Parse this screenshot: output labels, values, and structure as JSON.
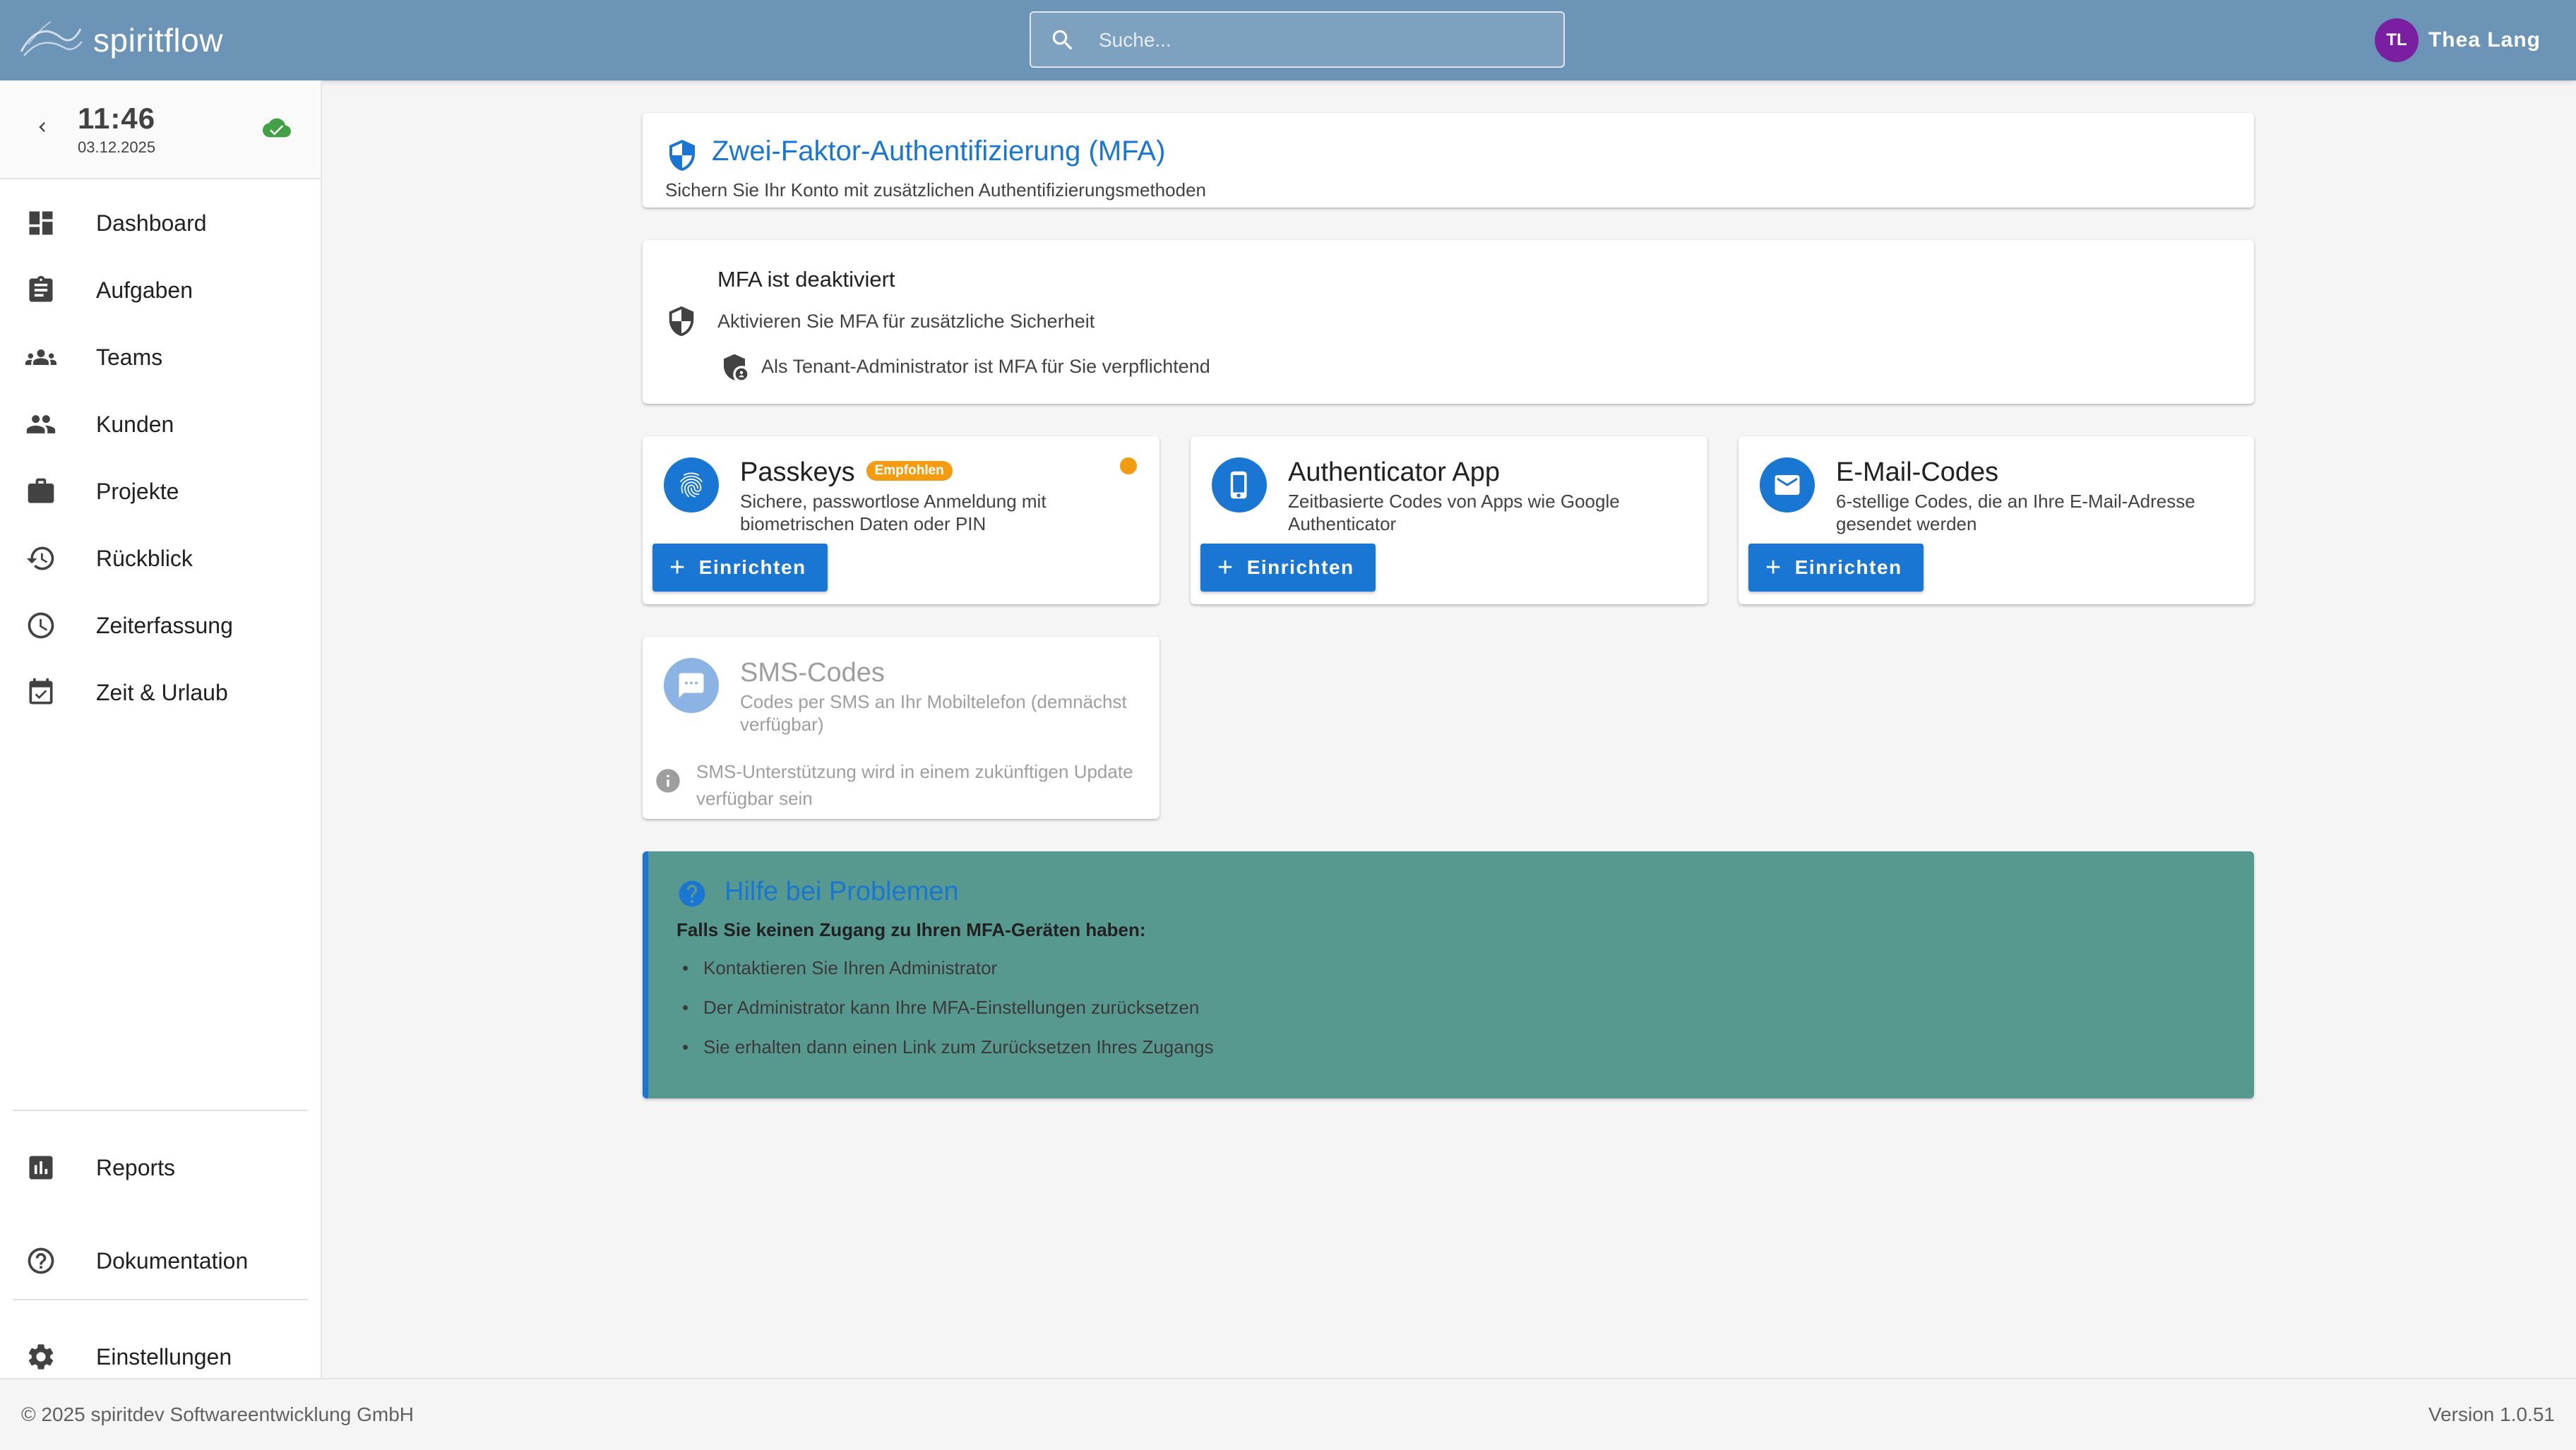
{
  "app": {
    "brand": "spiritflow"
  },
  "search": {
    "placeholder": "Suche..."
  },
  "user": {
    "initials": "TL",
    "name": "Thea Lang",
    "avatar_color": "#7b1fa2"
  },
  "clock": {
    "time": "11:46",
    "date": "03.12.2025",
    "sync_status_icon": "cloud-done-icon"
  },
  "sidebar": {
    "items": [
      {
        "label": "Dashboard",
        "icon": "dashboard-icon"
      },
      {
        "label": "Aufgaben",
        "icon": "assignment-icon"
      },
      {
        "label": "Teams",
        "icon": "groups-icon"
      },
      {
        "label": "Kunden",
        "icon": "people-icon"
      },
      {
        "label": "Projekte",
        "icon": "briefcase-icon"
      },
      {
        "label": "Rückblick",
        "icon": "history-icon"
      },
      {
        "label": "Zeiterfassung",
        "icon": "clock-icon"
      },
      {
        "label": "Zeit & Urlaub",
        "icon": "calendar-check-icon"
      }
    ],
    "bottom_items": [
      {
        "label": "Reports",
        "icon": "bar-chart-icon"
      },
      {
        "label": "Dokumentation",
        "icon": "help-circle-icon"
      },
      {
        "label": "Einstellungen",
        "icon": "gear-icon"
      }
    ]
  },
  "header": {
    "title": "Zwei-Faktor-Authentifizierung (MFA)",
    "subtitle": "Sichern Sie Ihr Konto mit zusätzlichen Authentifizierungsmethoden"
  },
  "status": {
    "title": "MFA ist deaktiviert",
    "description": "Aktivieren Sie MFA für zusätzliche Sicherheit",
    "note": "Als Tenant-Administrator ist MFA für Sie verpflichtend"
  },
  "methods": {
    "passkeys": {
      "title": "Passkeys",
      "badge": "Empfohlen",
      "description": "Sichere, passwortlose Anmeldung mit biometrischen Daten oder PIN",
      "button": "Einrichten"
    },
    "authenticator": {
      "title": "Authenticator App",
      "description": "Zeitbasierte Codes von Apps wie Google Authenticator",
      "button": "Einrichten"
    },
    "email": {
      "title": "E-Mail-Codes",
      "description": "6-stellige Codes, die an Ihre E-Mail-Adresse gesendet werden",
      "button": "Einrichten"
    },
    "sms": {
      "title": "SMS-Codes",
      "description": "Codes per SMS an Ihr Mobiltelefon (demnächst verfügbar)",
      "info": "SMS-Unterstützung wird in einem zukünftigen Update verfügbar sein"
    }
  },
  "help": {
    "title": "Hilfe bei Problemen",
    "lead": "Falls Sie keinen Zugang zu Ihren MFA-Geräten haben:",
    "items": [
      "Kontaktieren Sie Ihren Administrator",
      "Der Administrator kann Ihre MFA-Einstellungen zurücksetzen",
      "Sie erhalten dann einen Link zum Zurücksetzen Ihres Zugangs"
    ]
  },
  "footer": {
    "copyright": "© 2025 spiritdev Softwareentwicklung GmbH",
    "version": "Version 1.0.51"
  },
  "colors": {
    "topbar": "#6b94b7",
    "primary": "#1976d2",
    "badge": "#f39c12",
    "help_background": "#57998f",
    "sync_ok": "#43a047"
  }
}
